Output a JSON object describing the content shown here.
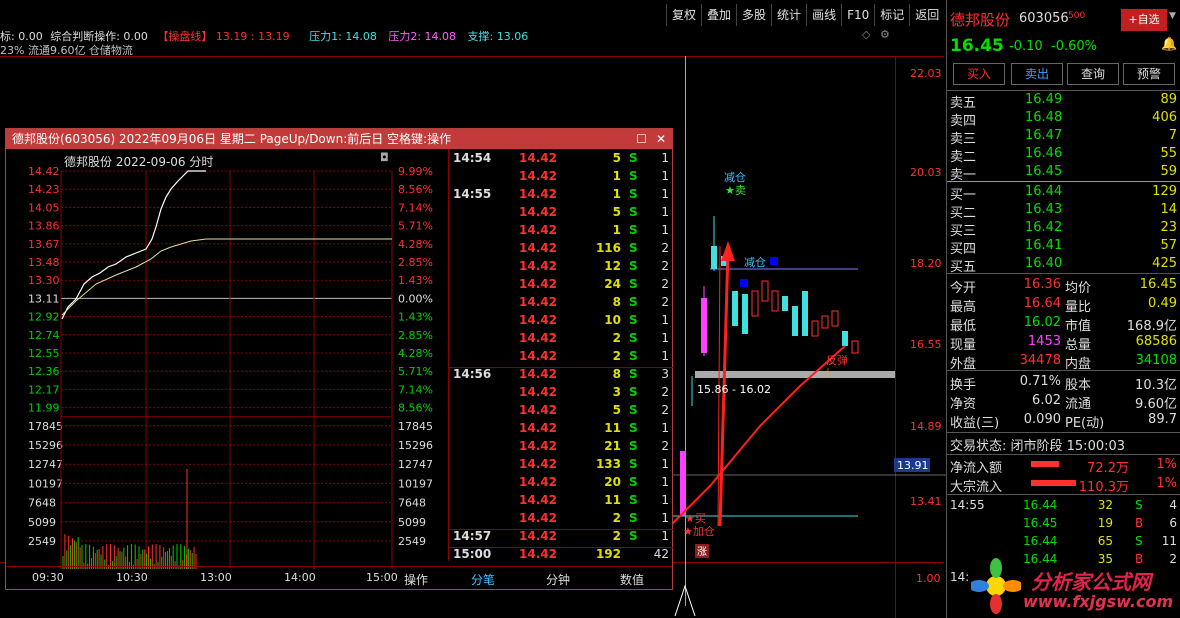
{
  "toolbar": [
    "复权",
    "叠加",
    "多股",
    "统计",
    "画线",
    "F10",
    "标记",
    "返回"
  ],
  "indicator_line": {
    "prefix": "标: 0.00",
    "zh": "综合判断操作: 0.00",
    "caopan": "【操盘线】",
    "v1": "13.19",
    "v2": "13.19",
    "press1": "压力1: 14.08",
    "press2": "压力2: 14.08",
    "support": "支撑: 13.06"
  },
  "info_line": "23% 流通9.60亿 仓储物流",
  "popup": {
    "title": "德邦股份(603056) 2022年09月06日 星期二 PageUp/Down:前后日 空格键:操作",
    "chart_title": "德邦股份  2022-09-06 分时",
    "price_ticks": [
      "14.42",
      "14.23",
      "14.05",
      "13.86",
      "13.67",
      "13.48",
      "13.30",
      "13.11",
      "12.92",
      "12.74",
      "12.55",
      "12.36",
      "12.17",
      "11.99"
    ],
    "pct_ticks": [
      "9.99%",
      "8.56%",
      "7.14%",
      "5.71%",
      "4.28%",
      "2.85%",
      "1.43%",
      "0.00%",
      "1.43%",
      "2.85%",
      "4.28%",
      "5.71%",
      "7.14%",
      "8.56%"
    ],
    "vol_ticks": [
      "17845",
      "15296",
      "12747",
      "10197",
      "7648",
      "5099",
      "2549"
    ],
    "time_ticks": [
      "09:30",
      "10:30",
      "13:00",
      "14:00",
      "15:00"
    ],
    "op_label": "操作",
    "tabs": [
      "分笔",
      "分钟",
      "数值"
    ],
    "ticks": [
      {
        "t": "14:54",
        "p": "14.42",
        "v": "5",
        "s": "S",
        "n": "1"
      },
      {
        "t": "",
        "p": "14.42",
        "v": "1",
        "s": "S",
        "n": "1"
      },
      {
        "t": "14:55",
        "p": "14.42",
        "v": "1",
        "s": "S",
        "n": "1"
      },
      {
        "t": "",
        "p": "14.42",
        "v": "5",
        "s": "S",
        "n": "1"
      },
      {
        "t": "",
        "p": "14.42",
        "v": "1",
        "s": "S",
        "n": "1"
      },
      {
        "t": "",
        "p": "14.42",
        "v": "116",
        "s": "S",
        "n": "2"
      },
      {
        "t": "",
        "p": "14.42",
        "v": "12",
        "s": "S",
        "n": "2"
      },
      {
        "t": "",
        "p": "14.42",
        "v": "24",
        "s": "S",
        "n": "2"
      },
      {
        "t": "",
        "p": "14.42",
        "v": "8",
        "s": "S",
        "n": "2"
      },
      {
        "t": "",
        "p": "14.42",
        "v": "10",
        "s": "S",
        "n": "1"
      },
      {
        "t": "",
        "p": "14.42",
        "v": "2",
        "s": "S",
        "n": "1"
      },
      {
        "t": "",
        "p": "14.42",
        "v": "2",
        "s": "S",
        "n": "1"
      },
      {
        "t": "14:56",
        "p": "14.42",
        "v": "8",
        "s": "S",
        "n": "3"
      },
      {
        "t": "",
        "p": "14.42",
        "v": "3",
        "s": "S",
        "n": "2"
      },
      {
        "t": "",
        "p": "14.42",
        "v": "5",
        "s": "S",
        "n": "2"
      },
      {
        "t": "",
        "p": "14.42",
        "v": "11",
        "s": "S",
        "n": "1"
      },
      {
        "t": "",
        "p": "14.42",
        "v": "21",
        "s": "S",
        "n": "2"
      },
      {
        "t": "",
        "p": "14.42",
        "v": "133",
        "s": "S",
        "n": "1"
      },
      {
        "t": "",
        "p": "14.42",
        "v": "20",
        "s": "S",
        "n": "1"
      },
      {
        "t": "",
        "p": "14.42",
        "v": "11",
        "s": "S",
        "n": "1"
      },
      {
        "t": "",
        "p": "14.42",
        "v": "2",
        "s": "S",
        "n": "1"
      },
      {
        "t": "14:57",
        "p": "14.42",
        "v": "2",
        "s": "S",
        "n": "1"
      },
      {
        "t": "15:00",
        "p": "14.42",
        "v": "192",
        "s": "",
        "n": "42"
      }
    ]
  },
  "kchart": {
    "price_labels": [
      "22.03",
      "20.03",
      "18.20",
      "16.55",
      "14.89",
      "13.41",
      "1.00"
    ],
    "price_box": "13.91",
    "ann_jiancang": "减仓",
    "ann_mai": "★卖",
    "ann_jiancang2": "减仓",
    "ann_range": "15.86 - 16.02",
    "ann_fantan": "反弹",
    "ann_mai_buy": "★买",
    "ann_jiacang": "★加仓",
    "ann_zhang": "涨"
  },
  "right": {
    "name": "德邦股份",
    "code": "603056",
    "code_sup": "500",
    "add_btn": "+自选",
    "price": "16.45",
    "chg": "-0.10",
    "chg_pct": "-0.60%",
    "buttons": [
      "买入",
      "卖出",
      "查询",
      "预警"
    ],
    "asks": [
      {
        "l": "卖五",
        "p": "16.49",
        "v": "89"
      },
      {
        "l": "卖四",
        "p": "16.48",
        "v": "406"
      },
      {
        "l": "卖三",
        "p": "16.47",
        "v": "7"
      },
      {
        "l": "卖二",
        "p": "16.46",
        "v": "55"
      },
      {
        "l": "卖一",
        "p": "16.45",
        "v": "59"
      }
    ],
    "bids": [
      {
        "l": "买一",
        "p": "16.44",
        "v": "129"
      },
      {
        "l": "买二",
        "p": "16.43",
        "v": "14"
      },
      {
        "l": "买三",
        "p": "16.42",
        "v": "23"
      },
      {
        "l": "买四",
        "p": "16.41",
        "v": "57"
      },
      {
        "l": "买五",
        "p": "16.40",
        "v": "425"
      }
    ],
    "stats": [
      {
        "l1": "今开",
        "v1": "16.36",
        "l2": "均价",
        "v2": "16.45"
      },
      {
        "l1": "最高",
        "v1": "16.64",
        "l2": "量比",
        "v2": "0.49"
      },
      {
        "l1": "最低",
        "v1": "16.02",
        "l2": "市值",
        "v2": "168.9亿"
      },
      {
        "l1": "现量",
        "v1": "1453",
        "l2": "总量",
        "v2": "68586"
      },
      {
        "l1": "外盘",
        "v1": "34478",
        "l2": "内盘",
        "v2": "34108"
      }
    ],
    "stats2": [
      {
        "l1": "换手",
        "v1": "0.71%",
        "l2": "股本",
        "v2": "10.3亿"
      },
      {
        "l1": "净资",
        "v1": "6.02",
        "l2": "流通",
        "v2": "9.60亿"
      },
      {
        "l1": "收益(三)",
        "v1": "0.090",
        "l2": "PE(动)",
        "v2": "89.7"
      }
    ],
    "trade_state": "交易状态: 闭市阶段 15:00:03",
    "flows": [
      {
        "l": "净流入额",
        "v": "72.2万",
        "p": "1%"
      },
      {
        "l": "大宗流入",
        "v": "110.3万",
        "p": "1%"
      }
    ],
    "deals": [
      {
        "t": "14:55",
        "p": "16.44",
        "v": "32",
        "s": "S",
        "n": "4"
      },
      {
        "t": "",
        "p": "16.45",
        "v": "19",
        "s": "B",
        "n": "6"
      },
      {
        "t": "",
        "p": "16.44",
        "v": "65",
        "s": "S",
        "n": "11"
      },
      {
        "t": "",
        "p": "16.44",
        "v": "35",
        "s": "B",
        "n": "2"
      }
    ],
    "deal_time2": "14:"
  },
  "watermark": {
    "cn": "分析家公式网",
    "url": "www.fxjgsw.com"
  },
  "colors": {
    "red": "#ff3030",
    "green": "#00d000",
    "yellow": "#e0e000",
    "cyan": "#40e0e0",
    "magenta": "#ff40ff"
  }
}
